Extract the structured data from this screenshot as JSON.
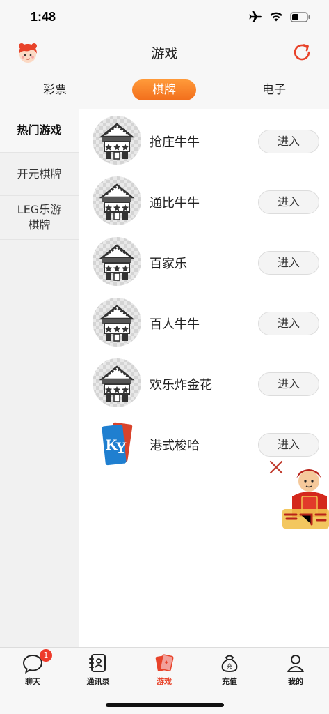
{
  "status_bar": {
    "time": "1:48",
    "icons": [
      "airplane-icon",
      "wifi-icon",
      "battery-icon"
    ]
  },
  "header": {
    "title": "游戏",
    "left_icon": "avatar-icon",
    "right_icon": "refresh-icon",
    "accent": "#e8432a"
  },
  "tabs": [
    {
      "label": "彩票",
      "active": false
    },
    {
      "label": "棋牌",
      "active": true
    },
    {
      "label": "电子",
      "active": false
    }
  ],
  "sidebar": {
    "items": [
      {
        "label": "热门游戏",
        "active": true
      },
      {
        "label": "开元棋牌",
        "active": false
      },
      {
        "label": "LEG乐游\n棋牌",
        "active": false
      }
    ]
  },
  "games": [
    {
      "name": "抢庄牛牛",
      "button": "进入",
      "icon": "slot-machine-icon"
    },
    {
      "name": "通比牛牛",
      "button": "进入",
      "icon": "slot-machine-icon"
    },
    {
      "name": "百家乐",
      "button": "进入",
      "icon": "slot-machine-icon"
    },
    {
      "name": "百人牛牛",
      "button": "进入",
      "icon": "slot-machine-icon"
    },
    {
      "name": "欢乐炸金花",
      "button": "进入",
      "icon": "slot-machine-icon"
    },
    {
      "name": "港式梭哈",
      "button": "进入",
      "icon": "ky-card-icon"
    }
  ],
  "floating_ad": {
    "close_icon": "close-icon",
    "image": "red-envelope-icon"
  },
  "bottom_nav": [
    {
      "label": "聊天",
      "icon": "chat-icon",
      "badge": "1",
      "active": false
    },
    {
      "label": "通讯录",
      "icon": "contacts-icon",
      "active": false
    },
    {
      "label": "游戏",
      "icon": "game-icon",
      "active": true
    },
    {
      "label": "充值",
      "icon": "recharge-icon",
      "active": false
    },
    {
      "label": "我的",
      "icon": "profile-icon",
      "active": false
    }
  ]
}
